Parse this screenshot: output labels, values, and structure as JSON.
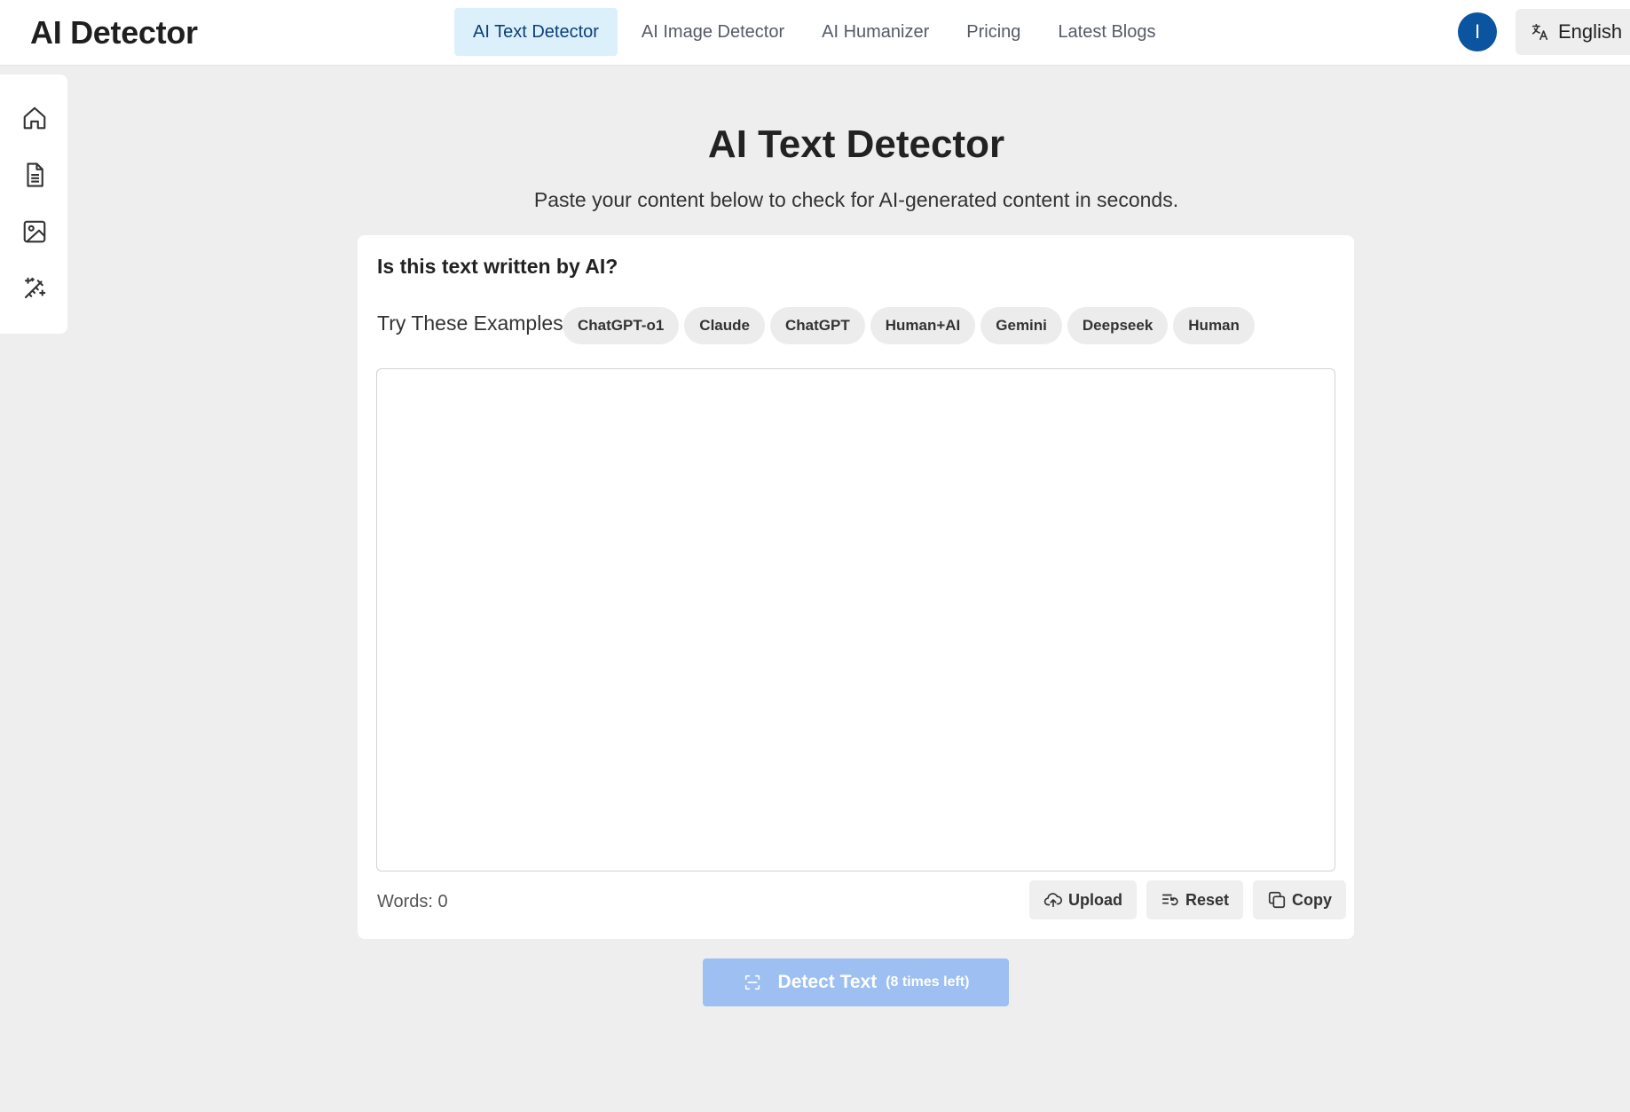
{
  "header": {
    "logo": "AI Detector",
    "nav": [
      {
        "label": "AI Text Detector",
        "active": true
      },
      {
        "label": "AI Image Detector",
        "active": false
      },
      {
        "label": "AI Humanizer",
        "active": false
      },
      {
        "label": "Pricing",
        "active": false
      },
      {
        "label": "Latest Blogs",
        "active": false
      }
    ],
    "avatar_initial": "I",
    "language": "English"
  },
  "sidebar": {
    "icons": [
      "home-icon",
      "document-icon",
      "image-icon",
      "magic-wand-icon"
    ]
  },
  "main": {
    "title": "AI Text Detector",
    "subtitle": "Paste your content below to check for AI-generated content in seconds."
  },
  "card": {
    "title": "Is this text written by AI?",
    "examples_label": "Try These Examples:",
    "examples": [
      "ChatGPT-o1",
      "Claude",
      "ChatGPT",
      "Human+AI",
      "Gemini",
      "Deepseek",
      "Human"
    ],
    "textarea_value": "",
    "word_count": "Words: 0",
    "actions": {
      "upload": "Upload",
      "reset": "Reset",
      "copy": "Copy"
    }
  },
  "detect_button": {
    "label": "Detect Text",
    "remaining": "(8 times left)"
  },
  "colors": {
    "accent": "#0a54a0",
    "nav_active_bg": "#dcf0fc",
    "detect_bg": "#9dbff1",
    "page_bg": "#eeeeee"
  }
}
